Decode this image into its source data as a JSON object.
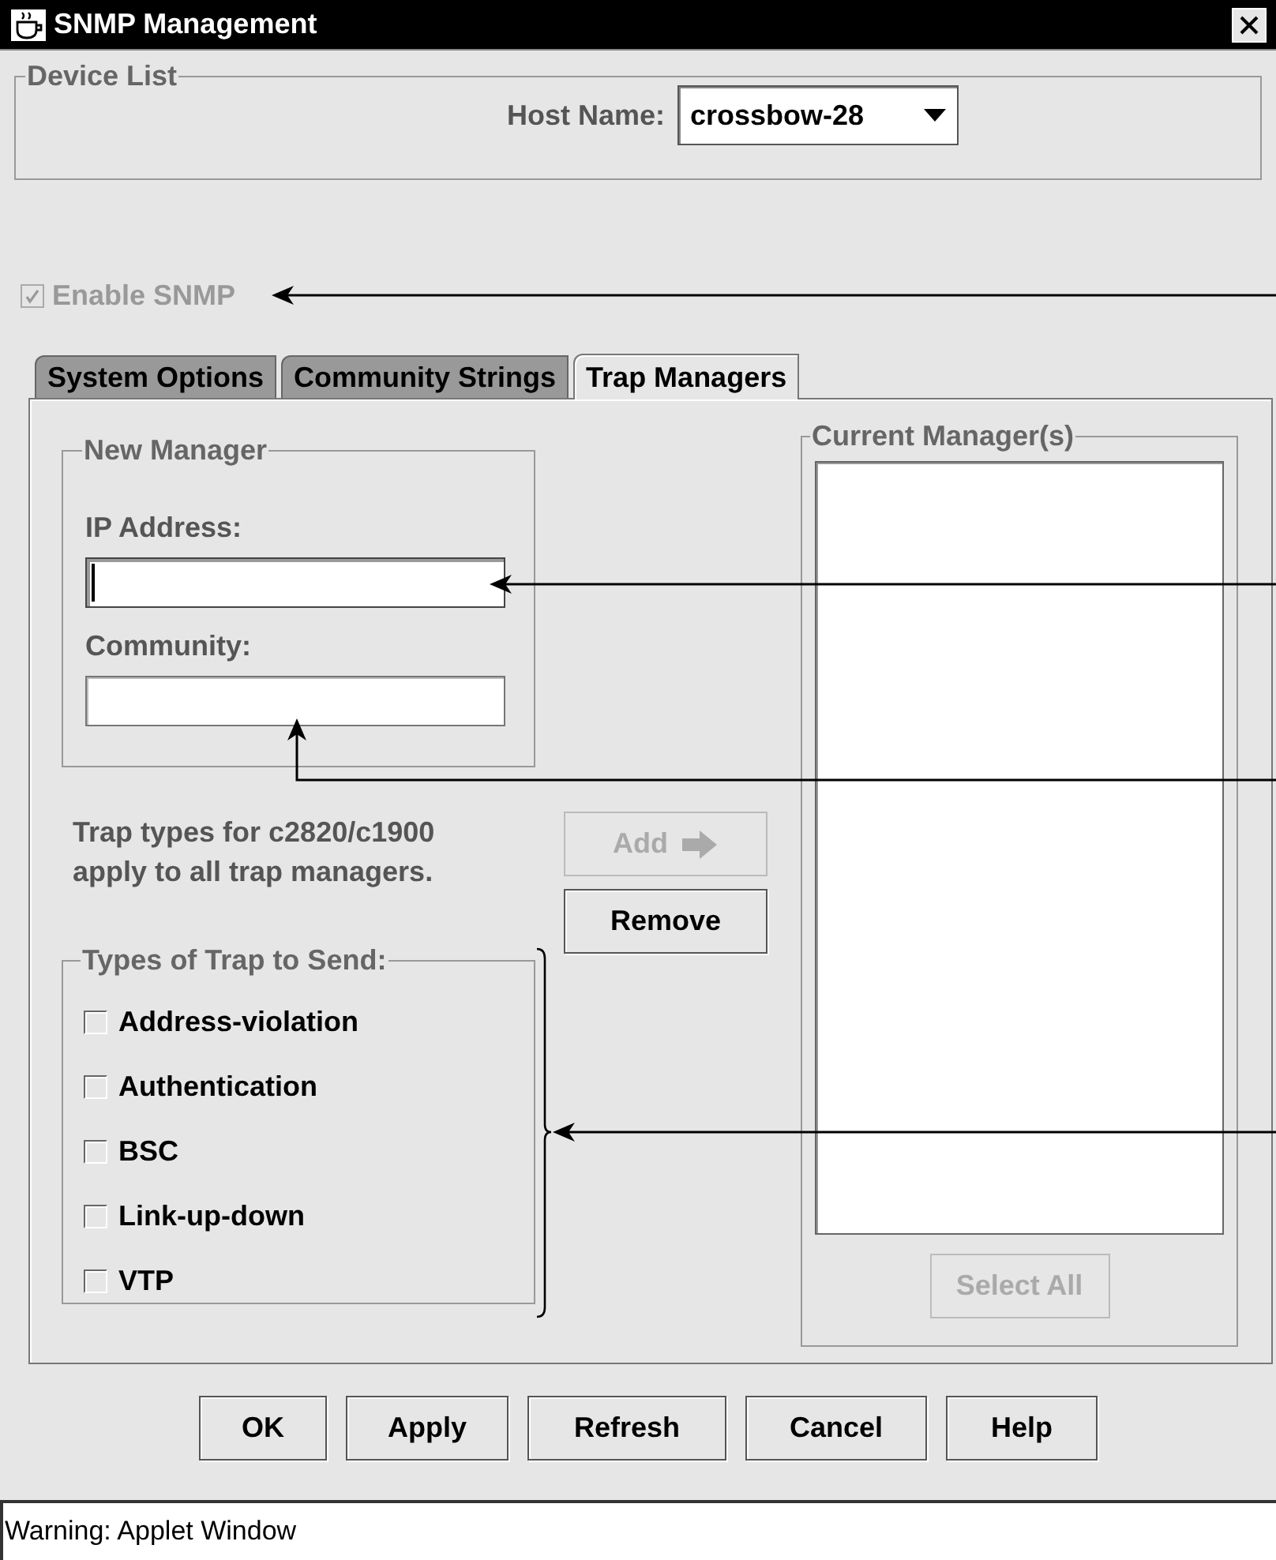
{
  "window": {
    "title": "SNMP Management"
  },
  "device_list": {
    "title": "Device List",
    "host_label": "Host Name:",
    "host_value": "crossbow-28"
  },
  "enable_snmp": {
    "label": "Enable SNMP",
    "checked": true,
    "disabled": true
  },
  "tabs": [
    {
      "label": "System Options",
      "selected": false
    },
    {
      "label": "Community Strings",
      "selected": false
    },
    {
      "label": "Trap Managers",
      "selected": true
    }
  ],
  "new_manager": {
    "title": "New Manager",
    "fields": [
      {
        "label": "IP Address:",
        "focused": true
      },
      {
        "label": "Community:",
        "focused": false
      }
    ]
  },
  "note": "Trap types for c2820/c1900\napply to all trap managers.",
  "actions": [
    {
      "label": "Add",
      "disabled": true,
      "kind": "add"
    },
    {
      "label": "Remove",
      "disabled": false,
      "kind": "plain"
    }
  ],
  "trap_types": {
    "title": "Types of Trap to Send:",
    "items": [
      {
        "label": "Address-violation",
        "checked": false
      },
      {
        "label": "Authentication",
        "checked": false
      },
      {
        "label": "BSC",
        "checked": false
      },
      {
        "label": "Link-up-down",
        "checked": false
      },
      {
        "label": "VTP",
        "checked": false
      }
    ]
  },
  "current_managers": {
    "title": "Current Manager(s)",
    "select_all": {
      "label": "Select All",
      "disabled": true
    }
  },
  "buttons": [
    "OK",
    "Apply",
    "Refresh",
    "Cancel",
    "Help"
  ],
  "status_bar": "Warning: Applet Window"
}
